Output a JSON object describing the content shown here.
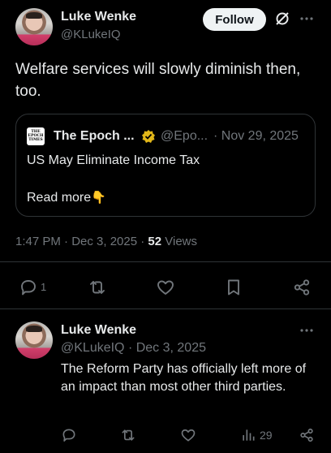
{
  "main_tweet": {
    "author_name": "Luke Wenke",
    "handle": "@KLukeIQ",
    "follow_label": "Follow",
    "text": "Welfare services will slowly diminish then, too.",
    "timestamp": "1:47 PM · Dec 3, 2025 · ",
    "views_count": "52",
    "views_label": " Views",
    "reply_count": "1"
  },
  "quoted_tweet": {
    "logo_text": "THE EPOCH TIMES",
    "author_name": "The Epoch ...",
    "handle": "@Epo...",
    "date": "· Nov 29, 2025",
    "title": "US May Eliminate Income Tax",
    "read_more": "Read more",
    "emoji": "👇"
  },
  "reply_tweet": {
    "author_name": "Luke Wenke",
    "handle_date": "@KLukeIQ · Dec 3, 2025",
    "text": "The Reform Party has officially left more of an impact than most other third parties.",
    "views_count": "29"
  },
  "colors": {
    "background": "#000000",
    "text": "#e7e9ea",
    "muted": "#71767b",
    "verified_gold": "#e2b719",
    "divider": "#2f3336"
  },
  "icons": [
    "grok-icon",
    "more-icon",
    "verified-badge-icon",
    "reply-icon",
    "retweet-icon",
    "like-icon",
    "bookmark-icon",
    "share-icon",
    "views-icon"
  ]
}
